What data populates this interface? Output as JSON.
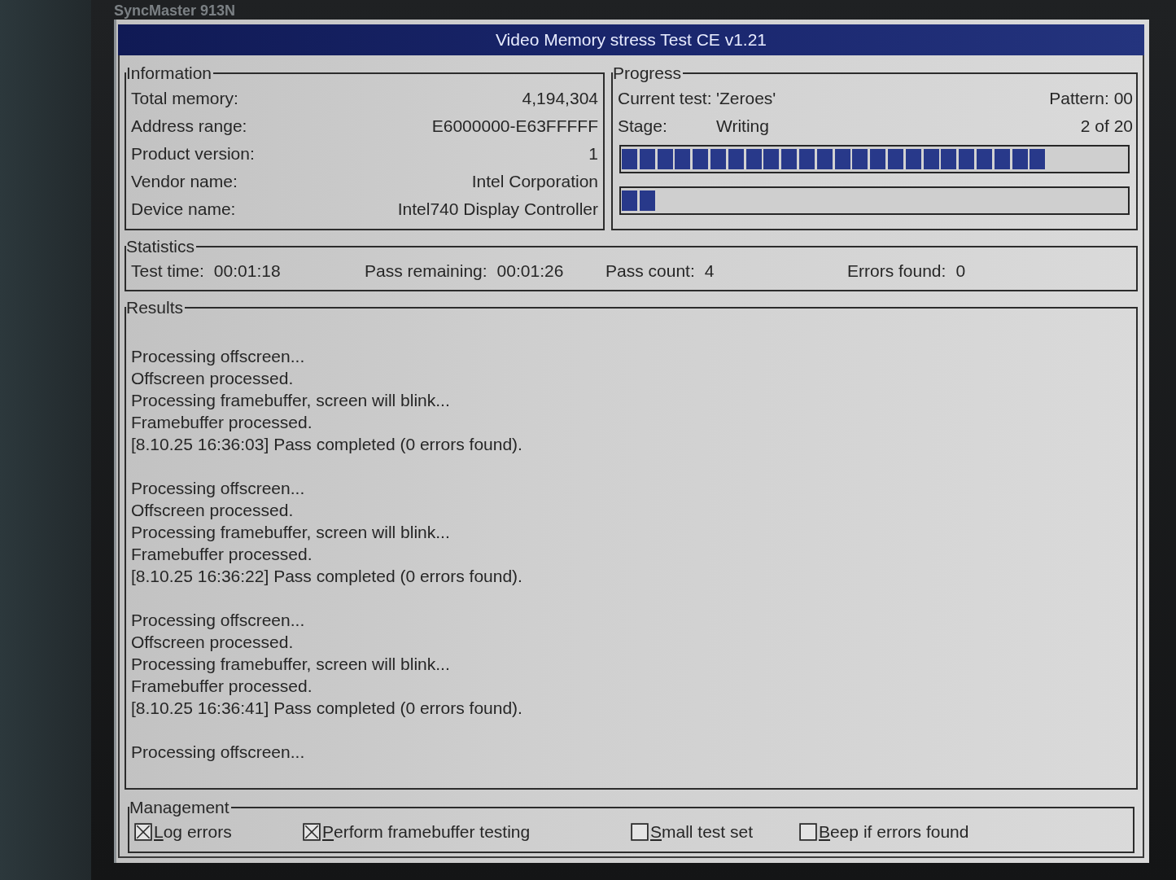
{
  "monitor": {
    "model": "SyncMaster 913N"
  },
  "window": {
    "title": "Video Memory stress Test CE v1.21"
  },
  "information": {
    "title": "Information",
    "rows": [
      {
        "label": "Total memory:",
        "value": "4,194,304"
      },
      {
        "label": "Address range:",
        "value": "E6000000-E63FFFFF"
      },
      {
        "label": "Product version:",
        "value": "1"
      },
      {
        "label": "Vendor name:",
        "value": "Intel Corporation"
      },
      {
        "label": "Device name:",
        "value": "Intel740 Display Controller"
      }
    ]
  },
  "progress": {
    "title": "Progress",
    "current_test_label": "Current test:",
    "current_test": "'Zeroes'",
    "pattern": "Pattern: 00",
    "stage_label": "Stage:",
    "stage": "Writing",
    "stage_count": "2 of 20",
    "bars": [
      {
        "level": 0.84
      },
      {
        "level": 0.07
      }
    ]
  },
  "statistics": {
    "title": "Statistics",
    "items": [
      {
        "label": "Test time:",
        "value": "00:01:18"
      },
      {
        "label": "Pass remaining:",
        "value": "00:01:26"
      },
      {
        "label": "Pass count:",
        "value": "4"
      },
      {
        "label": "Errors found:",
        "value": "0"
      }
    ]
  },
  "results": {
    "title": "Results",
    "passes": [
      [
        "Processing offscreen...",
        "Offscreen processed.",
        "Processing framebuffer, screen will blink...",
        "Framebuffer processed.",
        "[8.10.25 16:36:03] Pass completed (0 errors found)."
      ],
      [
        "Processing offscreen...",
        "Offscreen processed.",
        "Processing framebuffer, screen will blink...",
        "Framebuffer processed.",
        "[8.10.25 16:36:22] Pass completed (0 errors found)."
      ],
      [
        "Processing offscreen...",
        "Offscreen processed.",
        "Processing framebuffer, screen will blink...",
        "Framebuffer processed.",
        "[8.10.25 16:36:41] Pass completed (0 errors found)."
      ],
      [
        "Processing offscreen..."
      ]
    ]
  },
  "management": {
    "title": "Management",
    "options": [
      {
        "label": "Log errors",
        "checked": true
      },
      {
        "label": "Perform framebuffer testing",
        "checked": true
      },
      {
        "label": "Small test set",
        "checked": false
      },
      {
        "label": "Beep if errors found",
        "checked": false
      }
    ]
  }
}
